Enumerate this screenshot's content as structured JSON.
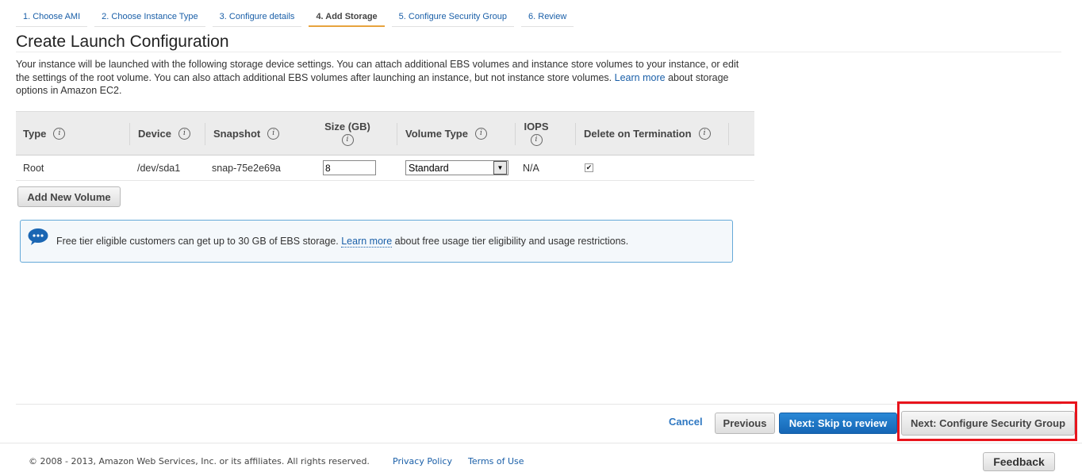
{
  "steps": [
    {
      "label": "1. Choose AMI"
    },
    {
      "label": "2. Choose Instance Type"
    },
    {
      "label": "3. Configure details"
    },
    {
      "label": "4. Add Storage"
    },
    {
      "label": "5. Configure Security Group"
    },
    {
      "label": "6. Review"
    }
  ],
  "active_step": "4. Add Storage",
  "page_title": "Create Launch Configuration",
  "description": {
    "text_part1": "Your instance will be launched with the following storage device settings. You can attach additional EBS volumes and instance store volumes to your instance, or edit the settings of the root volume. You can also attach additional EBS volumes after launching an instance, but not instance store volumes.",
    "link": "Learn more",
    "text_part2": "about storage options in Amazon EC2."
  },
  "table": {
    "headers": {
      "type": "Type",
      "device": "Device",
      "snapshot": "Snapshot",
      "size": "Size (GB)",
      "volume_type": "Volume Type",
      "iops": "IOPS",
      "delete_on_termination": "Delete on Termination"
    },
    "info_glyph": "i",
    "row": {
      "type": "Root",
      "device": "/dev/sda1",
      "snapshot": "snap-75e2e69a",
      "size": "8",
      "volume_type": "Standard",
      "iops": "N/A",
      "delete_on_termination": true
    }
  },
  "add_volume_button": "Add New Volume",
  "notice": {
    "text_part1": "Free tier eligible customers can get up to 30 GB of EBS storage.",
    "link": "Learn more",
    "text_part2": "about free usage tier eligibility and usage restrictions."
  },
  "actions": {
    "cancel": "Cancel",
    "previous": "Previous",
    "skip_to_review": "Next: Skip to review",
    "next": "Next: Configure Security Group"
  },
  "footer": {
    "copyright": "© 2008 - 2013, Amazon Web Services, Inc. or its affiliates. All rights reserved.",
    "privacy": "Privacy Policy",
    "terms": "Terms of Use",
    "feedback": "Feedback"
  },
  "colors": {
    "link": "#1a5fa8",
    "primary_button": "#1a72c4",
    "active_step_underline": "#e7a33e",
    "highlight_box": "#e8141c"
  }
}
